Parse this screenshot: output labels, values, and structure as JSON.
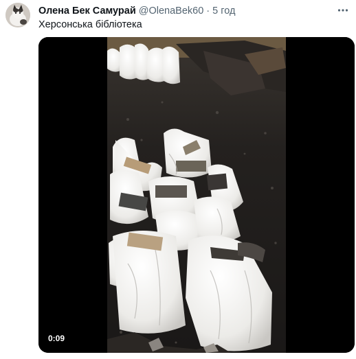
{
  "tweet": {
    "author_name": "Олена Бек Самурай",
    "author_handle": "@OlenaBek60",
    "separator": "·",
    "time": "5 год",
    "text": "Херсонська бібліотека",
    "avatar_icon": "cat-avatar-icon",
    "more_icon": "more-dots-icon"
  },
  "media": {
    "video_duration": "0:09",
    "scene": "burned-library-floor-with-white-sacks-of-books"
  },
  "colors": {
    "text_primary": "#0f1419",
    "text_secondary": "#536471",
    "media_background": "#000000"
  }
}
